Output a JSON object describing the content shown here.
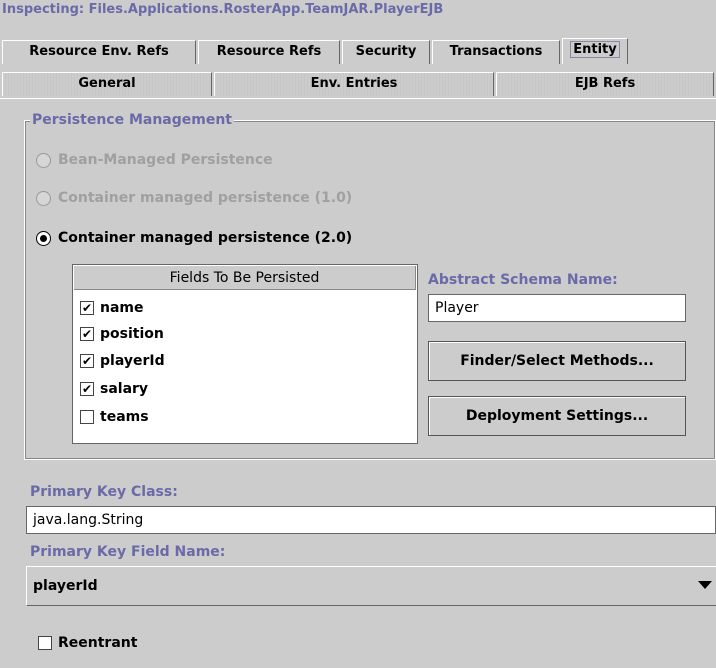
{
  "header": {
    "title": "Inspecting: Files.Applications.RosterApp.TeamJAR.PlayerEJB"
  },
  "tabs_row1": [
    "Resource Env. Refs",
    "Resource Refs",
    "Security",
    "Transactions",
    "Entity"
  ],
  "tabs_row2": [
    "General",
    "Env. Entries",
    "EJB Refs"
  ],
  "active_tab": "Entity",
  "persistence": {
    "group_title": "Persistence Management",
    "options": [
      {
        "label": "Bean-Managed Persistence",
        "enabled": false,
        "selected": false
      },
      {
        "label": "Container managed persistence (1.0)",
        "enabled": false,
        "selected": false
      },
      {
        "label": "Container managed persistence (2.0)",
        "enabled": true,
        "selected": true
      }
    ],
    "fields_header": "Fields To Be Persisted",
    "fields": [
      {
        "name": "name",
        "checked": true
      },
      {
        "name": "position",
        "checked": true
      },
      {
        "name": "playerId",
        "checked": true
      },
      {
        "name": "salary",
        "checked": true
      },
      {
        "name": "teams",
        "checked": false
      }
    ],
    "schema_label": "Abstract Schema Name:",
    "schema_value": "Player",
    "finder_button": "Finder/Select Methods...",
    "deploy_button": "Deployment Settings..."
  },
  "primary_key": {
    "class_label": "Primary Key Class:",
    "class_value": "java.lang.String",
    "field_label": "Primary Key Field Name:",
    "field_value": "playerId"
  },
  "reentrant": {
    "label": "Reentrant",
    "checked": false
  },
  "check_mark": "✔"
}
